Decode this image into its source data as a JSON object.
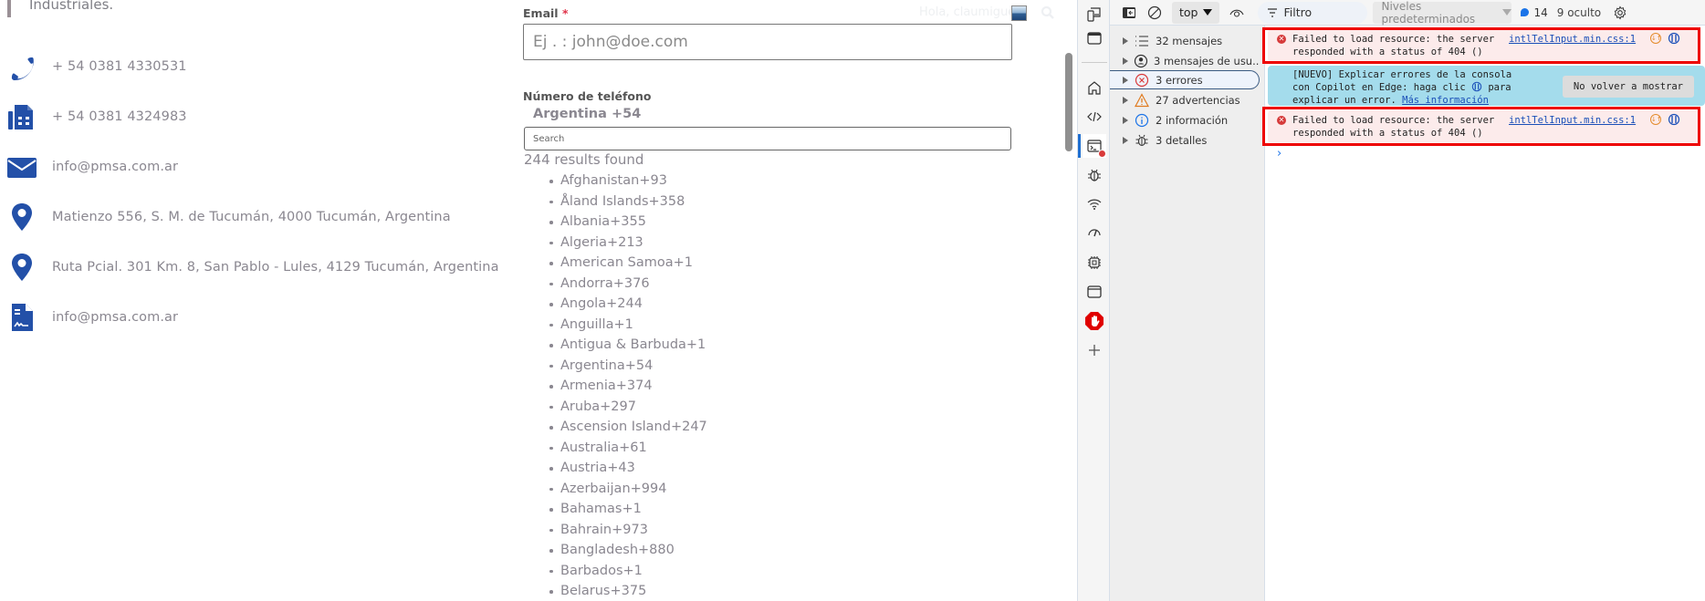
{
  "page": {
    "quote_text": "Industriales.",
    "contacts": [
      {
        "icon": "phone-icon",
        "text": "+ 54 0381 4330531"
      },
      {
        "icon": "fax-icon",
        "text": "+ 54 0381 4324983"
      },
      {
        "icon": "envelope-icon",
        "text": "info@pmsa.com.ar"
      },
      {
        "icon": "map-pin-icon",
        "text": "Matienzo 556, S. M. de Tucumán, 4000 Tucumán, Argentina"
      },
      {
        "icon": "map-pin-icon",
        "text": "Ruta Pcial. 301 Km. 8, San Pablo - Lules, 4129 Tucumán, Argentina"
      },
      {
        "icon": "document-signature-icon",
        "text": "info@pmsa.com.ar"
      }
    ],
    "icon_color": "#2350a8",
    "header": {
      "greeting": "Hola, claumigue"
    },
    "form": {
      "email_label": "Email",
      "required_mark": "*",
      "email_placeholder": "Ej . : john@doe.com",
      "email_value": "",
      "phone_label": "Número de teléfono",
      "selected_country": "Argentina +54",
      "search_placeholder": "Search",
      "search_value": "",
      "results_count": "244 results found",
      "countries": [
        "Afghanistan+93",
        "Åland Islands+358",
        "Albania+355",
        "Algeria+213",
        "American Samoa+1",
        "Andorra+376",
        "Angola+244",
        "Anguilla+1",
        "Antigua & Barbuda+1",
        "Argentina+54",
        "Armenia+374",
        "Aruba+297",
        "Ascension Island+247",
        "Australia+61",
        "Austria+43",
        "Azerbaijan+994",
        "Bahamas+1",
        "Bahrain+973",
        "Bangladesh+880",
        "Barbados+1",
        "Belarus+375"
      ]
    }
  },
  "devtools": {
    "toolbar": {
      "context": "top",
      "filter_placeholder": "Filtro",
      "levels": "Niveles predeterminados",
      "issues_count": "14",
      "hidden": "9 oculto"
    },
    "sidebar": [
      {
        "icon": "list-icon",
        "label": "32 mensajes"
      },
      {
        "icon": "user-circle-icon",
        "label": "3 mensajes de usu..."
      },
      {
        "icon": "error-circle-icon",
        "label": "3 errores",
        "selected": true
      },
      {
        "icon": "warning-triangle-icon",
        "label": "27 advertencias"
      },
      {
        "icon": "info-circle-icon",
        "label": "2 información"
      },
      {
        "icon": "bug-icon",
        "label": "3 detalles"
      }
    ],
    "messages": [
      {
        "type": "error",
        "line1": "Failed to load resource: the server",
        "line2": "responded with a status of 404 ()",
        "source": "intlTelInput.min.css:1"
      },
      {
        "type": "error",
        "line1": "Failed to load resource: the server",
        "line2": "responded with a status of 404 ()",
        "source": "intlTelInput.min.css:1"
      }
    ],
    "tip": {
      "line1": "[NUEVO] Explicar errores de la consola",
      "line2a": "con Copilot en Edge: haga clic",
      "line2b": "para",
      "line3": "explicar un error.",
      "link": "Más información",
      "dismiss": "No volver a mostrar"
    },
    "prompt": "›",
    "colors": {
      "error_bg": "#fcebeb",
      "highlight": "#ee0000",
      "tip_bg": "#a4dcec",
      "link": "#1a4fb8"
    }
  }
}
